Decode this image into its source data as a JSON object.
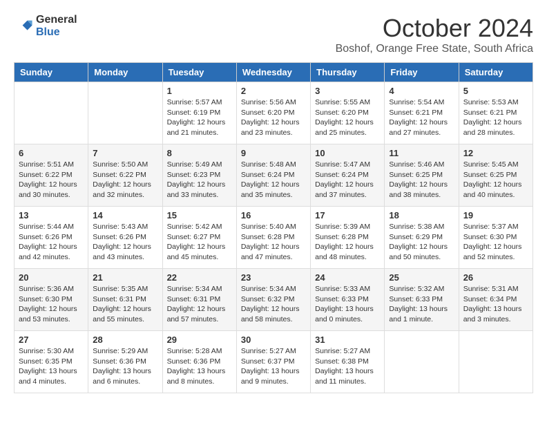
{
  "header": {
    "logo_general": "General",
    "logo_blue": "Blue",
    "month": "October 2024",
    "location": "Boshof, Orange Free State, South Africa"
  },
  "days_of_week": [
    "Sunday",
    "Monday",
    "Tuesday",
    "Wednesday",
    "Thursday",
    "Friday",
    "Saturday"
  ],
  "weeks": [
    [
      {
        "day": "",
        "info": ""
      },
      {
        "day": "",
        "info": ""
      },
      {
        "day": "1",
        "info": "Sunrise: 5:57 AM\nSunset: 6:19 PM\nDaylight: 12 hours\nand 21 minutes."
      },
      {
        "day": "2",
        "info": "Sunrise: 5:56 AM\nSunset: 6:20 PM\nDaylight: 12 hours\nand 23 minutes."
      },
      {
        "day": "3",
        "info": "Sunrise: 5:55 AM\nSunset: 6:20 PM\nDaylight: 12 hours\nand 25 minutes."
      },
      {
        "day": "4",
        "info": "Sunrise: 5:54 AM\nSunset: 6:21 PM\nDaylight: 12 hours\nand 27 minutes."
      },
      {
        "day": "5",
        "info": "Sunrise: 5:53 AM\nSunset: 6:21 PM\nDaylight: 12 hours\nand 28 minutes."
      }
    ],
    [
      {
        "day": "6",
        "info": "Sunrise: 5:51 AM\nSunset: 6:22 PM\nDaylight: 12 hours\nand 30 minutes."
      },
      {
        "day": "7",
        "info": "Sunrise: 5:50 AM\nSunset: 6:22 PM\nDaylight: 12 hours\nand 32 minutes."
      },
      {
        "day": "8",
        "info": "Sunrise: 5:49 AM\nSunset: 6:23 PM\nDaylight: 12 hours\nand 33 minutes."
      },
      {
        "day": "9",
        "info": "Sunrise: 5:48 AM\nSunset: 6:24 PM\nDaylight: 12 hours\nand 35 minutes."
      },
      {
        "day": "10",
        "info": "Sunrise: 5:47 AM\nSunset: 6:24 PM\nDaylight: 12 hours\nand 37 minutes."
      },
      {
        "day": "11",
        "info": "Sunrise: 5:46 AM\nSunset: 6:25 PM\nDaylight: 12 hours\nand 38 minutes."
      },
      {
        "day": "12",
        "info": "Sunrise: 5:45 AM\nSunset: 6:25 PM\nDaylight: 12 hours\nand 40 minutes."
      }
    ],
    [
      {
        "day": "13",
        "info": "Sunrise: 5:44 AM\nSunset: 6:26 PM\nDaylight: 12 hours\nand 42 minutes."
      },
      {
        "day": "14",
        "info": "Sunrise: 5:43 AM\nSunset: 6:26 PM\nDaylight: 12 hours\nand 43 minutes."
      },
      {
        "day": "15",
        "info": "Sunrise: 5:42 AM\nSunset: 6:27 PM\nDaylight: 12 hours\nand 45 minutes."
      },
      {
        "day": "16",
        "info": "Sunrise: 5:40 AM\nSunset: 6:28 PM\nDaylight: 12 hours\nand 47 minutes."
      },
      {
        "day": "17",
        "info": "Sunrise: 5:39 AM\nSunset: 6:28 PM\nDaylight: 12 hours\nand 48 minutes."
      },
      {
        "day": "18",
        "info": "Sunrise: 5:38 AM\nSunset: 6:29 PM\nDaylight: 12 hours\nand 50 minutes."
      },
      {
        "day": "19",
        "info": "Sunrise: 5:37 AM\nSunset: 6:30 PM\nDaylight: 12 hours\nand 52 minutes."
      }
    ],
    [
      {
        "day": "20",
        "info": "Sunrise: 5:36 AM\nSunset: 6:30 PM\nDaylight: 12 hours\nand 53 minutes."
      },
      {
        "day": "21",
        "info": "Sunrise: 5:35 AM\nSunset: 6:31 PM\nDaylight: 12 hours\nand 55 minutes."
      },
      {
        "day": "22",
        "info": "Sunrise: 5:34 AM\nSunset: 6:31 PM\nDaylight: 12 hours\nand 57 minutes."
      },
      {
        "day": "23",
        "info": "Sunrise: 5:34 AM\nSunset: 6:32 PM\nDaylight: 12 hours\nand 58 minutes."
      },
      {
        "day": "24",
        "info": "Sunrise: 5:33 AM\nSunset: 6:33 PM\nDaylight: 13 hours\nand 0 minutes."
      },
      {
        "day": "25",
        "info": "Sunrise: 5:32 AM\nSunset: 6:33 PM\nDaylight: 13 hours\nand 1 minute."
      },
      {
        "day": "26",
        "info": "Sunrise: 5:31 AM\nSunset: 6:34 PM\nDaylight: 13 hours\nand 3 minutes."
      }
    ],
    [
      {
        "day": "27",
        "info": "Sunrise: 5:30 AM\nSunset: 6:35 PM\nDaylight: 13 hours\nand 4 minutes."
      },
      {
        "day": "28",
        "info": "Sunrise: 5:29 AM\nSunset: 6:36 PM\nDaylight: 13 hours\nand 6 minutes."
      },
      {
        "day": "29",
        "info": "Sunrise: 5:28 AM\nSunset: 6:36 PM\nDaylight: 13 hours\nand 8 minutes."
      },
      {
        "day": "30",
        "info": "Sunrise: 5:27 AM\nSunset: 6:37 PM\nDaylight: 13 hours\nand 9 minutes."
      },
      {
        "day": "31",
        "info": "Sunrise: 5:27 AM\nSunset: 6:38 PM\nDaylight: 13 hours\nand 11 minutes."
      },
      {
        "day": "",
        "info": ""
      },
      {
        "day": "",
        "info": ""
      }
    ]
  ]
}
